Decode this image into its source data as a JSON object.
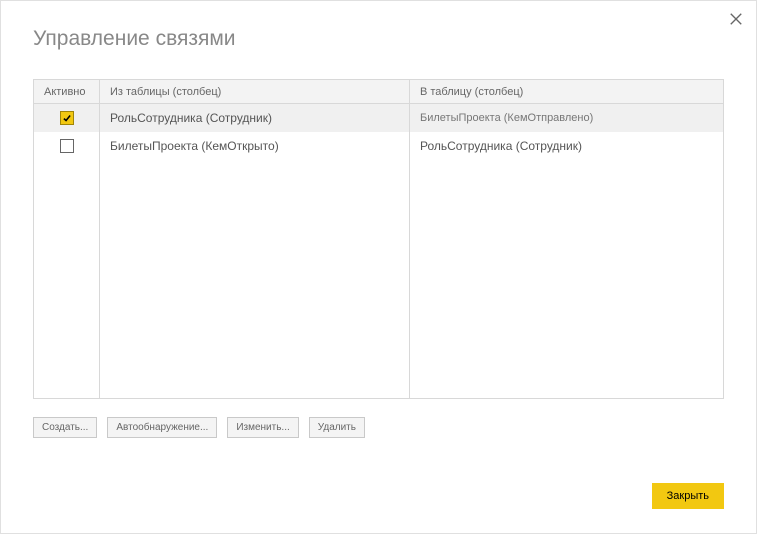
{
  "dialog": {
    "title": "Управление связями"
  },
  "table": {
    "headers": {
      "active": "Активно",
      "from": "Из таблицы (столбец)",
      "to": "В таблицу (столбец)"
    },
    "rows": [
      {
        "active": true,
        "selected": true,
        "from": "РольСотрудника (Сотрудник)",
        "to": "БилетыПроекта (КемОтправлено)"
      },
      {
        "active": false,
        "selected": false,
        "from": "БилетыПроекта (КемОткрыто)",
        "to": "РольСотрудника (Сотрудник)"
      }
    ]
  },
  "actions": {
    "create": "Создать...",
    "autodetect": "Автообнаружение...",
    "edit": "Изменить...",
    "delete": "Удалить"
  },
  "footer": {
    "close": "Закрыть"
  }
}
